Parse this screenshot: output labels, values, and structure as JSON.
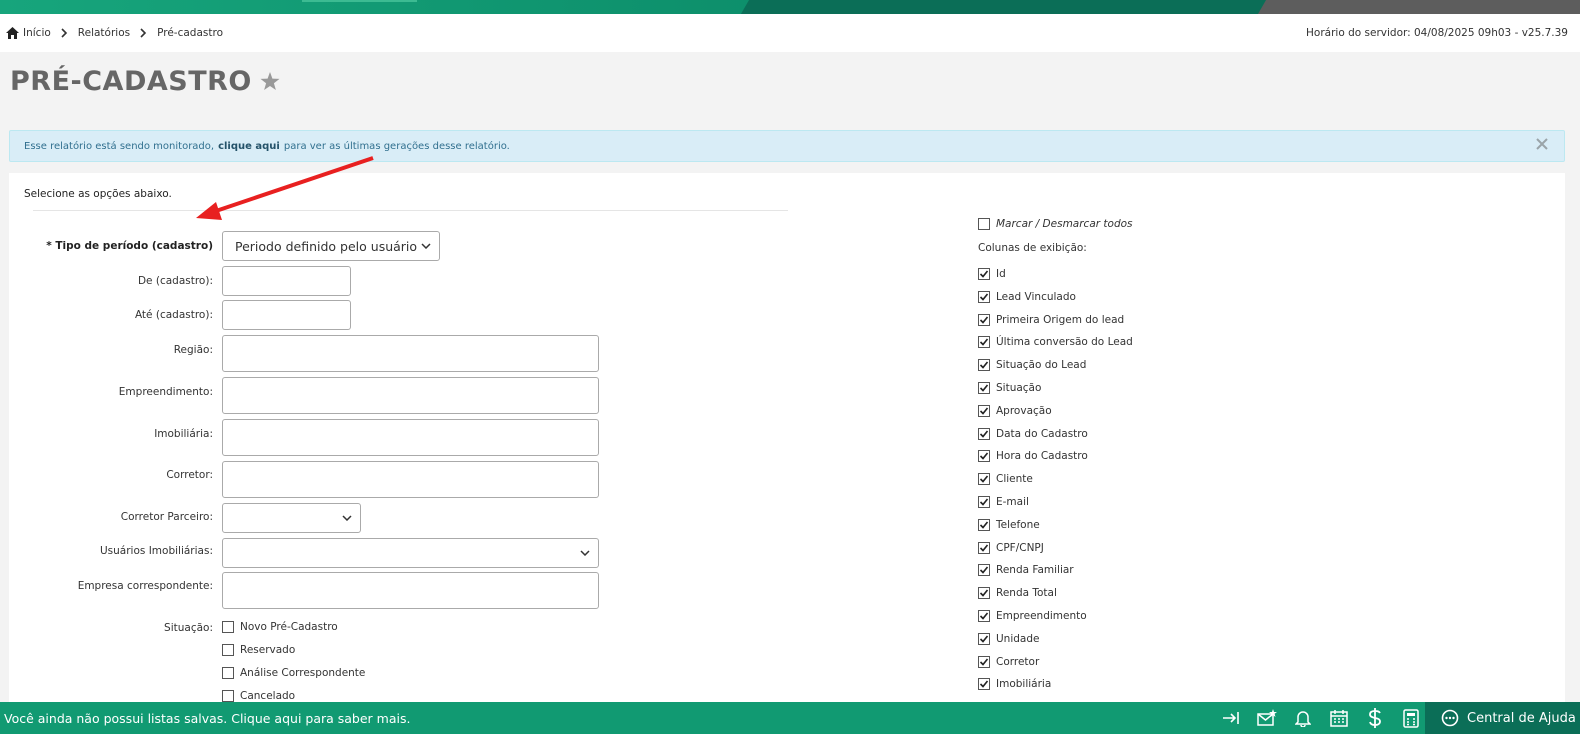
{
  "breadcrumb": {
    "home": "Início",
    "reports": "Relatórios",
    "current": "Pré-cadastro"
  },
  "server_time": "Horário do servidor: 04/08/2025 09h03 - v25.7.39",
  "page_title": "PRÉ-CADASTRO",
  "alert": {
    "text_before": "Esse relatório está sendo monitorado,",
    "link": "clique aqui",
    "text_after": "para ver as últimas gerações desse relatório."
  },
  "form": {
    "instructions": "Selecione as opções abaixo.",
    "period_type_label": "* Tipo de período (cadastro)",
    "period_type_value": "Periodo definido pelo usuário",
    "from_label": "De (cadastro):",
    "from_value": "",
    "to_label": "Até (cadastro):",
    "to_value": "",
    "region_label": "Região:",
    "development_label": "Empreendimento:",
    "realestate_label": "Imobiliária:",
    "broker_label": "Corretor:",
    "partner_broker_label": "Corretor Parceiro:",
    "partner_broker_value": "",
    "realestate_users_label": "Usuários Imobiliárias:",
    "realestate_users_value": "",
    "correspondent_company_label": "Empresa correspondente:",
    "status_label": "Situação:",
    "status_options": [
      {
        "label": "Novo Pré-Cadastro",
        "checked": false
      },
      {
        "label": "Reservado",
        "checked": false
      },
      {
        "label": "Análise Correspondente",
        "checked": false
      },
      {
        "label": "Cancelado",
        "checked": false
      }
    ]
  },
  "columns": {
    "toggle_all_label": "Marcar / Desmarcar todos",
    "toggle_all_checked": false,
    "heading": "Colunas de exibição:",
    "items": [
      {
        "label": "Id",
        "checked": true
      },
      {
        "label": "Lead Vinculado",
        "checked": true
      },
      {
        "label": "Primeira Origem do lead",
        "checked": true
      },
      {
        "label": "Última conversão do Lead",
        "checked": true
      },
      {
        "label": "Situação do Lead",
        "checked": true
      },
      {
        "label": "Situação",
        "checked": true
      },
      {
        "label": "Aprovação",
        "checked": true
      },
      {
        "label": "Data do Cadastro",
        "checked": true
      },
      {
        "label": "Hora do Cadastro",
        "checked": true
      },
      {
        "label": "Cliente",
        "checked": true
      },
      {
        "label": "E-mail",
        "checked": true
      },
      {
        "label": "Telefone",
        "checked": true
      },
      {
        "label": "CPF/CNPJ",
        "checked": true
      },
      {
        "label": "Renda Familiar",
        "checked": true
      },
      {
        "label": "Renda Total",
        "checked": true
      },
      {
        "label": "Empreendimento",
        "checked": true
      },
      {
        "label": "Unidade",
        "checked": true
      },
      {
        "label": "Corretor",
        "checked": true
      },
      {
        "label": "Imobiliária",
        "checked": true
      }
    ]
  },
  "footer": {
    "message": "Você ainda não possui listas salvas. Clique aqui para saber mais.",
    "icons": [
      "collapse-arrow-icon",
      "mail-star-icon",
      "bell-icon",
      "calendar-icon",
      "dollar-icon",
      "calculator-icon"
    ],
    "help_label": "Central de Ajuda"
  },
  "colors": {
    "brand_green": "#119a72",
    "dark_green": "#0b6e57",
    "alert_bg": "#d9edf7",
    "annotation_arrow": "#e82020"
  }
}
